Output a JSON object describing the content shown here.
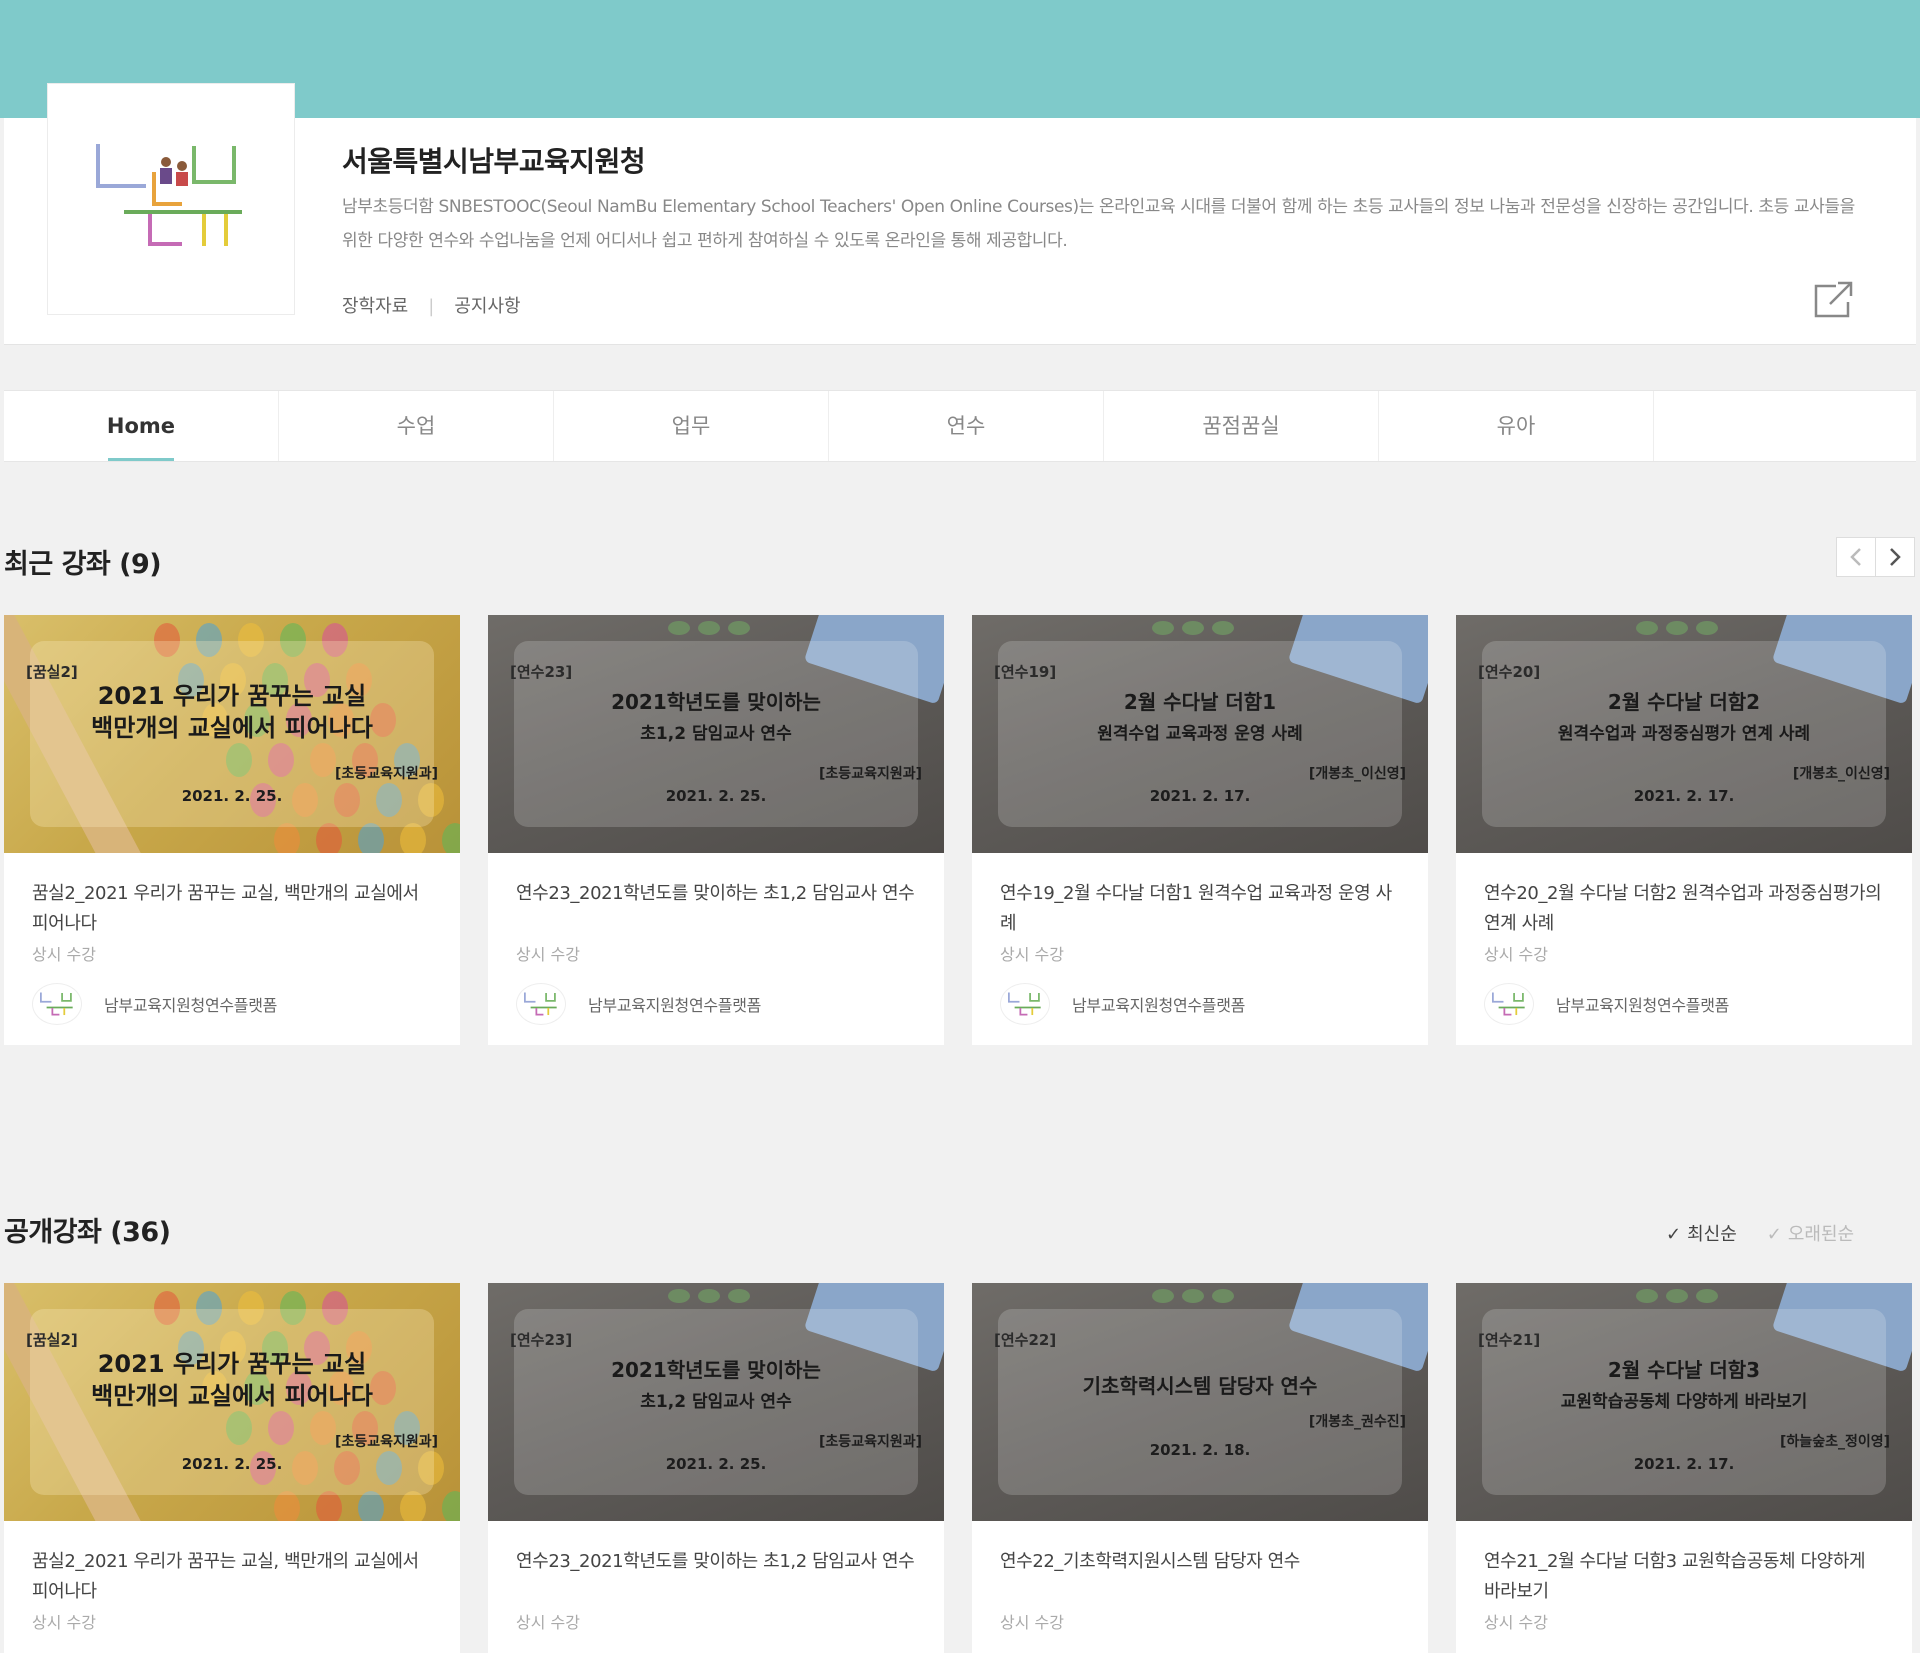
{
  "channel": {
    "title": "서울특별시남부교육지원청",
    "description": "남부초등더함 SNBESTOOC(Seoul NamBu Elementary School Teachers' Open Online Courses)는 온라인교육 시대를 더불어 함께 하는 초등 교사들의 정보 나눔과 전문성을 신장하는 공간입니다. 초등 교사들을 위한 다양한 연수와 수업나눔을 언제 어디서나 쉽고 편하게 참여하실 수 있도록 온라인을 통해 제공합니다.",
    "links": [
      "장학자료",
      "공지사항"
    ]
  },
  "tabs": [
    "Home",
    "수업",
    "업무",
    "연수",
    "꿈점꿈실",
    "유아"
  ],
  "recent": {
    "title": "최근 강좌 (9)",
    "cards": [
      {
        "thumb": {
          "style": "abacus",
          "tag": "[꿈실2]",
          "lines": [
            "2021 우리가 꿈꾸는 교실",
            "백만개의 교실에서 피어나다"
          ],
          "sub": "[초등교육지원과]",
          "date": "2021. 2. 25."
        },
        "title": "꿈실2_2021 우리가 꿈꾸는 교실, 백만개의 교실에서 피어나다",
        "status": "상시 수강",
        "owner": "남부교육지원청연수플랫폼"
      },
      {
        "thumb": {
          "style": "desk",
          "tag": "[연수23]",
          "lines": [
            "2021학년도를 맞이하는",
            "초1,2 담임교사 연수"
          ],
          "sub": "[초등교육지원과]",
          "date": "2021. 2. 25."
        },
        "title": "연수23_2021학년도를 맞이하는 초1,2 담임교사 연수",
        "status": "상시 수강",
        "owner": "남부교육지원청연수플랫폼"
      },
      {
        "thumb": {
          "style": "desk",
          "tag": "[연수19]",
          "lines": [
            "2월 수다날 더함1",
            "원격수업 교육과정 운영 사례"
          ],
          "sub": "[개봉초_이신영]",
          "date": "2021. 2. 17."
        },
        "title": "연수19_2월 수다날 더함1 원격수업 교육과정 운영 사례",
        "status": "상시 수강",
        "owner": "남부교육지원청연수플랫폼"
      },
      {
        "thumb": {
          "style": "desk",
          "tag": "[연수20]",
          "lines": [
            "2월 수다날 더함2",
            "원격수업과 과정중심평가 연계 사례"
          ],
          "sub": "[개봉초_이신영]",
          "date": "2021. 2. 17."
        },
        "title": "연수20_2월 수다날 더함2 원격수업과 과정중심평가의 연계 사례",
        "status": "상시 수강",
        "owner": "남부교육지원청연수플랫폼"
      }
    ]
  },
  "public": {
    "title": "공개강좌 (36)",
    "sort": [
      "최신순",
      "오래된순"
    ],
    "cards": [
      {
        "thumb": {
          "style": "abacus",
          "tag": "[꿈실2]",
          "lines": [
            "2021 우리가 꿈꾸는 교실",
            "백만개의 교실에서 피어나다"
          ],
          "sub": "[초등교육지원과]",
          "date": "2021. 2. 25."
        },
        "title": "꿈실2_2021 우리가 꿈꾸는 교실, 백만개의 교실에서 피어나다",
        "status": "상시 수강"
      },
      {
        "thumb": {
          "style": "desk",
          "tag": "[연수23]",
          "lines": [
            "2021학년도를 맞이하는",
            "초1,2 담임교사 연수"
          ],
          "sub": "[초등교육지원과]",
          "date": "2021. 2. 25."
        },
        "title": "연수23_2021학년도를 맞이하는 초1,2 담임교사 연수",
        "status": "상시 수강"
      },
      {
        "thumb": {
          "style": "desk",
          "tag": "[연수22]",
          "lines": [
            "기초학력시스템 담당자 연수"
          ],
          "sub": "[개봉초_권수진]",
          "date": "2021. 2. 18."
        },
        "title": "연수22_기초학력지원시스템 담당자 연수",
        "status": "상시 수강"
      },
      {
        "thumb": {
          "style": "desk",
          "tag": "[연수21]",
          "lines": [
            "2월 수다날 더함3",
            "교원학습공동체 다양하게 바라보기"
          ],
          "sub": "[하늘숲초_정이영]",
          "date": "2021. 2. 17."
        },
        "title": "연수21_2월 수다날 더함3 교원학습공동체 다양하게 바라보기",
        "status": "상시 수강"
      }
    ]
  },
  "colors": {
    "accent": "#7fcaca",
    "background": "#f1f1f1"
  }
}
